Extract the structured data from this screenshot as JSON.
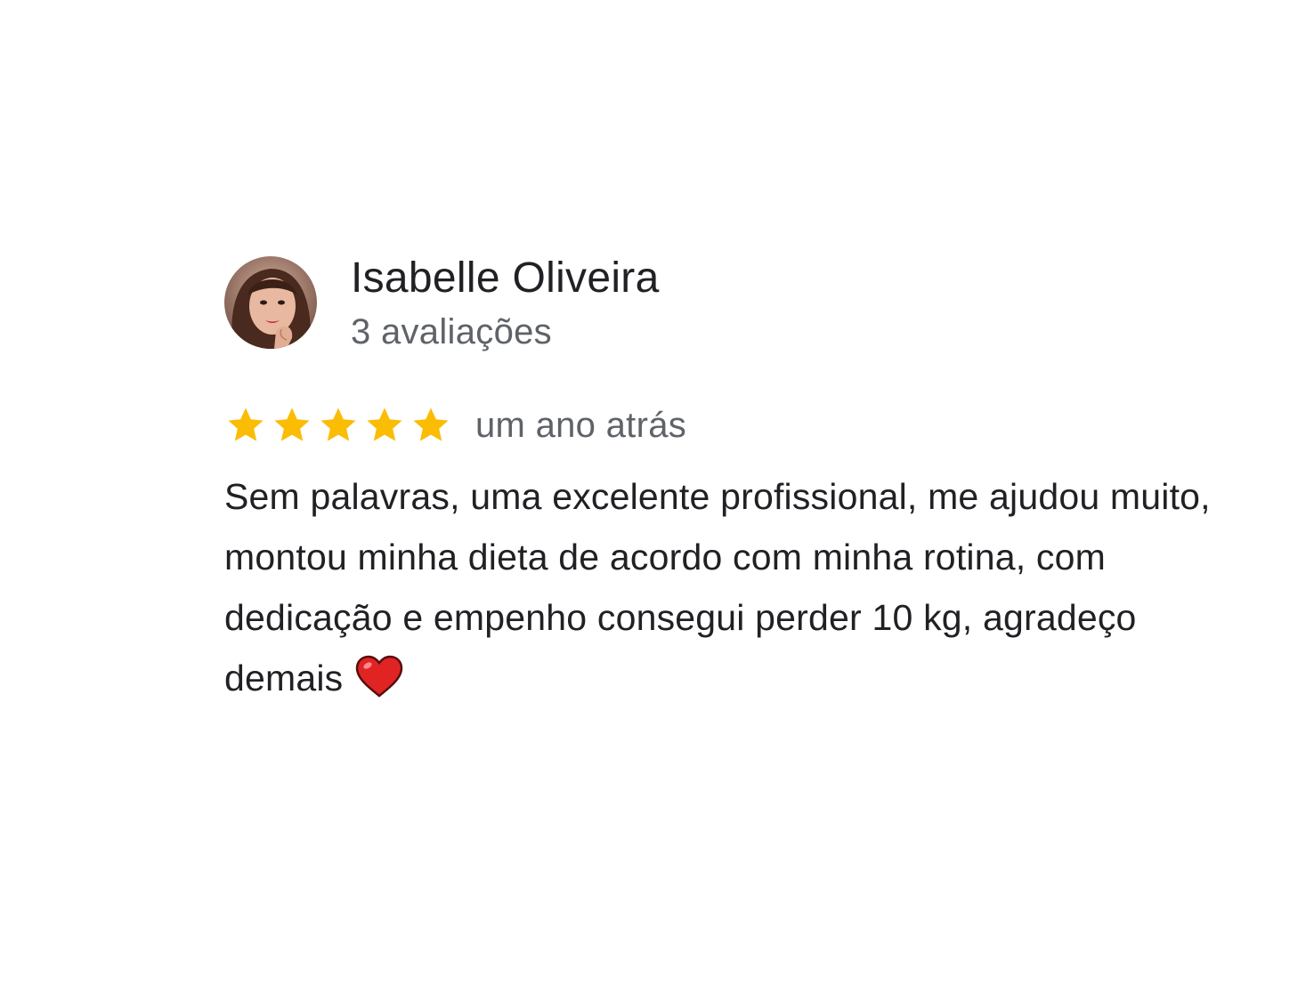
{
  "review": {
    "reviewer_name": "Isabelle Oliveira",
    "review_count": "3 avaliações",
    "rating": 5,
    "rating_max": 5,
    "date": "um ano atrás",
    "text": "Sem palavras, uma excelente profissional, me ajudou muito, montou minha dieta de acordo com minha rotina, com dedicação e empenho consegui perder 10 kg, agradeço demais",
    "avatar_icon": "profile-photo",
    "star_icon": "star-icon",
    "emoji_icon": "red-heart-icon"
  },
  "colors": {
    "star": "#FBBC04",
    "heart": "#E02424",
    "name_text": "#202124",
    "meta_text": "#5F6368"
  }
}
